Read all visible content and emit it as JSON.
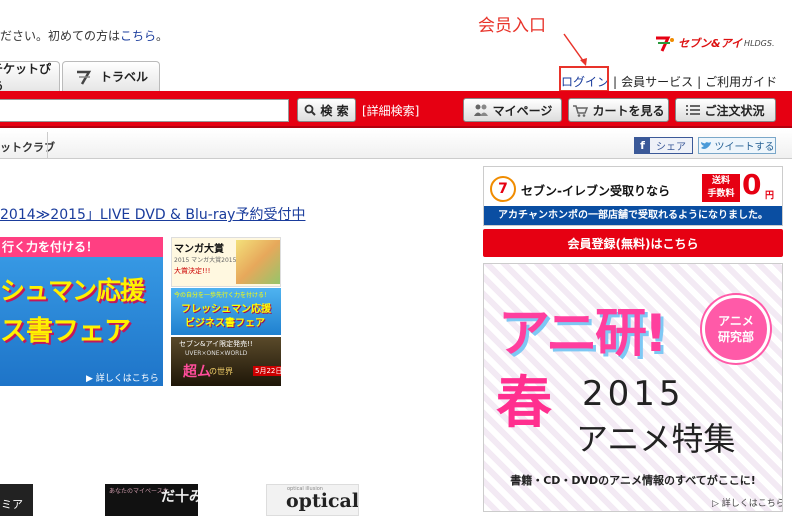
{
  "header": {
    "welcome_text": "ださい。初めての方は",
    "welcome_link": "こちら",
    "welcome_end": "。",
    "annotation": "会员入口",
    "logo_text": "セブン&アイ",
    "logo_sub": "HLDGS."
  },
  "tabs": [
    {
      "label": "チケットぴあ"
    },
    {
      "label": "トラベル"
    }
  ],
  "toplinks": {
    "login": "ログイン",
    "member_service": "会員サービス",
    "guide": "ご利用ガイド",
    "separator": "|"
  },
  "search": {
    "value": "",
    "button_label": "検 索",
    "advanced_link": "[詳細検索]"
  },
  "actions": {
    "mypage": "マイページ",
    "cart": "カートを見る",
    "orders": "ご注文状況"
  },
  "subnav": {
    "item": "ットクラブ",
    "share": "シェア",
    "tweet": "ツイートする"
  },
  "main": {
    "headline": "2014≫2015」LIVE DVD & Blu-ray予約受付中",
    "banner_main": {
      "top": "行く力を付ける！",
      "line1": "シュマン応援",
      "line2": "ス書フェア",
      "more": "▶ 詳しくはこちら"
    },
    "side_banners": [
      {
        "a": "マンガ大賞",
        "b": "2015 マンガ大賞2015",
        "c": "大賞決定!!!"
      },
      {
        "a": "今の自分を一歩先行く力を付ける！",
        "b": "フレッシュマン応援",
        "c": "ビジネス書フェア"
      },
      {
        "a": "セブン&アイ限定発売!!",
        "b": "UVER×ONE×WORLD",
        "c": "超ム",
        "d": "の世界",
        "e": "5月22日"
      }
    ],
    "thumbs": [
      {
        "a": "ミア"
      },
      {
        "a": "あなたのマイペースな",
        "b": "だ十み\nっ四ん"
      },
      {
        "a": "optical illusion",
        "b": "optical"
      }
    ]
  },
  "right": {
    "seven": {
      "logo": "7",
      "title": "セブン-イレブン受取りなら",
      "fee_label": "送料\n手数料",
      "zero": "0",
      "yen": "円",
      "bar": "アカチャンホンポの一部店舗で受取れるようになりました。"
    },
    "register": "会員登録(無料)はこちら",
    "anime": {
      "title": "アニ研!",
      "circle_line1": "アニメ",
      "circle_line2": "研究部",
      "spring": "春",
      "year": "2015",
      "feature": "アニメ特集",
      "sub": "書籍・CD・DVDのアニメ情報のすべてがここに!",
      "more": "▷ 詳しくはこちら"
    }
  },
  "colors": {
    "brand_red": "#e60012",
    "annotation_red": "#e8332a",
    "link_blue": "#1a3c9c"
  }
}
